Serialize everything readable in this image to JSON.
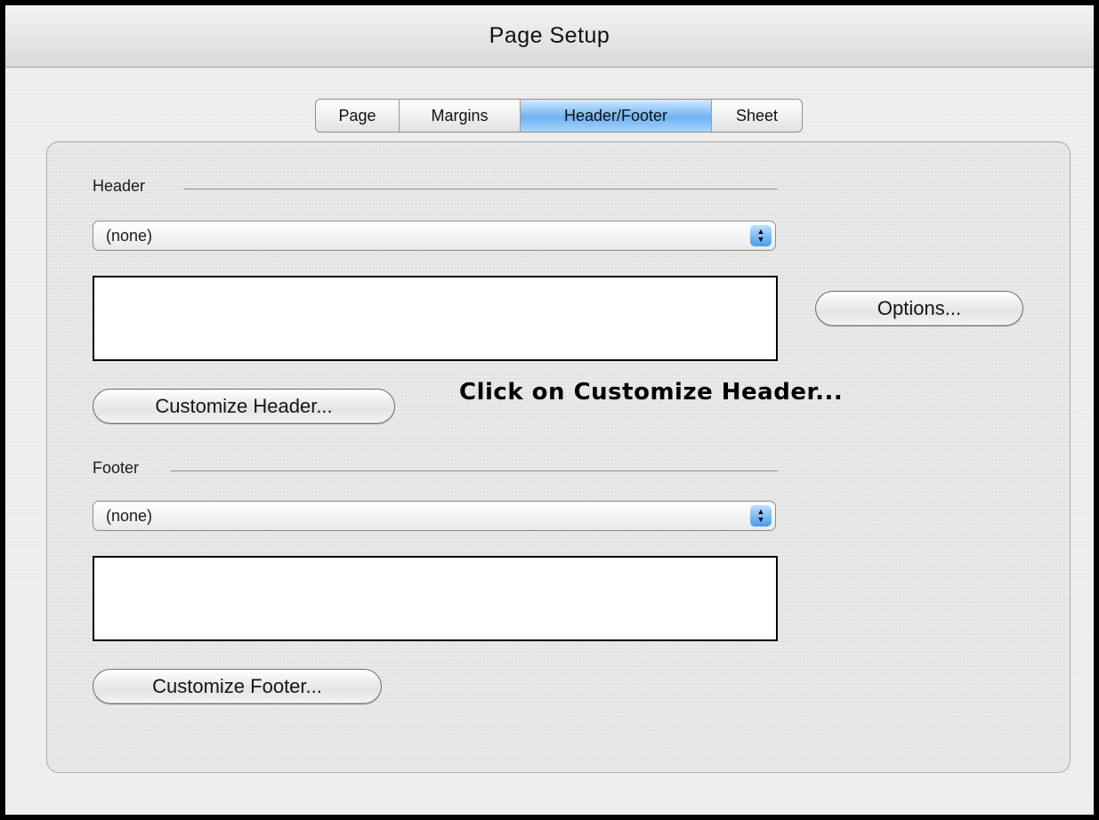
{
  "window": {
    "title": "Page Setup"
  },
  "tabs": [
    {
      "label": "Page",
      "active": false
    },
    {
      "label": "Margins",
      "active": false
    },
    {
      "label": "Header/Footer",
      "active": true
    },
    {
      "label": "Sheet",
      "active": false
    }
  ],
  "header_section": {
    "label": "Header",
    "select_value": "(none)",
    "customize_button": "Customize Header..."
  },
  "footer_section": {
    "label": "Footer",
    "select_value": "(none)",
    "customize_button": "Customize Footer..."
  },
  "options_button": "Options...",
  "annotation": "Click on Customize Header...",
  "colors": {
    "active_tab": "#6fb2f2",
    "select_arrow": "#4a9ae8",
    "window_border": "#000000"
  },
  "icons": {
    "select_arrows": "updown-arrows-icon"
  }
}
